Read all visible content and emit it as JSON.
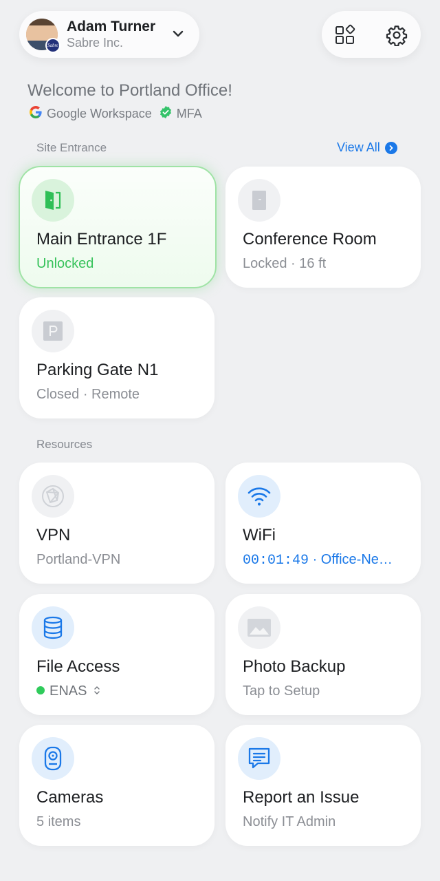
{
  "header": {
    "user_name": "Adam Turner",
    "organization": "Sabre Inc.",
    "avatar_badge": "Sabre",
    "icons": [
      "chevron-down-icon",
      "apps-grid-icon",
      "gear-icon"
    ]
  },
  "welcome": {
    "title": "Welcome to Portland Office!",
    "identity_provider": "Google Workspace",
    "mfa_label": "MFA"
  },
  "site_entrance": {
    "section_title": "Site Entrance",
    "view_all_label": "View All",
    "cards": [
      {
        "title": "Main Entrance 1F",
        "status": "Unlocked",
        "icon": "door-open-icon",
        "state": "active"
      },
      {
        "title": "Conference Room",
        "status": "Locked · 16 ft",
        "icon": "door-closed-icon",
        "state": "idle"
      },
      {
        "title": "Parking Gate N1",
        "status": "Closed · Remote",
        "icon": "parking-icon",
        "state": "idle"
      }
    ]
  },
  "resources": {
    "section_title": "Resources",
    "cards": [
      {
        "title": "VPN",
        "subtitle": "Portland-VPN",
        "icon": "globe-network-icon"
      },
      {
        "title": "WiFi",
        "timer": "00:01:49",
        "network": " · Office-Ne…",
        "icon": "wifi-icon"
      },
      {
        "title": "File Access",
        "subtitle": "ENAS",
        "icon": "database-icon"
      },
      {
        "title": "Photo Backup",
        "subtitle": "Tap to Setup",
        "icon": "image-icon"
      },
      {
        "title": "Cameras",
        "subtitle": "5 items",
        "icon": "camera-icon"
      },
      {
        "title": "Report an Issue",
        "subtitle": "Notify IT Admin",
        "icon": "chat-message-icon"
      }
    ]
  },
  "colors": {
    "accent_blue": "#1a78e8",
    "success_green": "#36c25a",
    "background": "#eff0f2"
  }
}
